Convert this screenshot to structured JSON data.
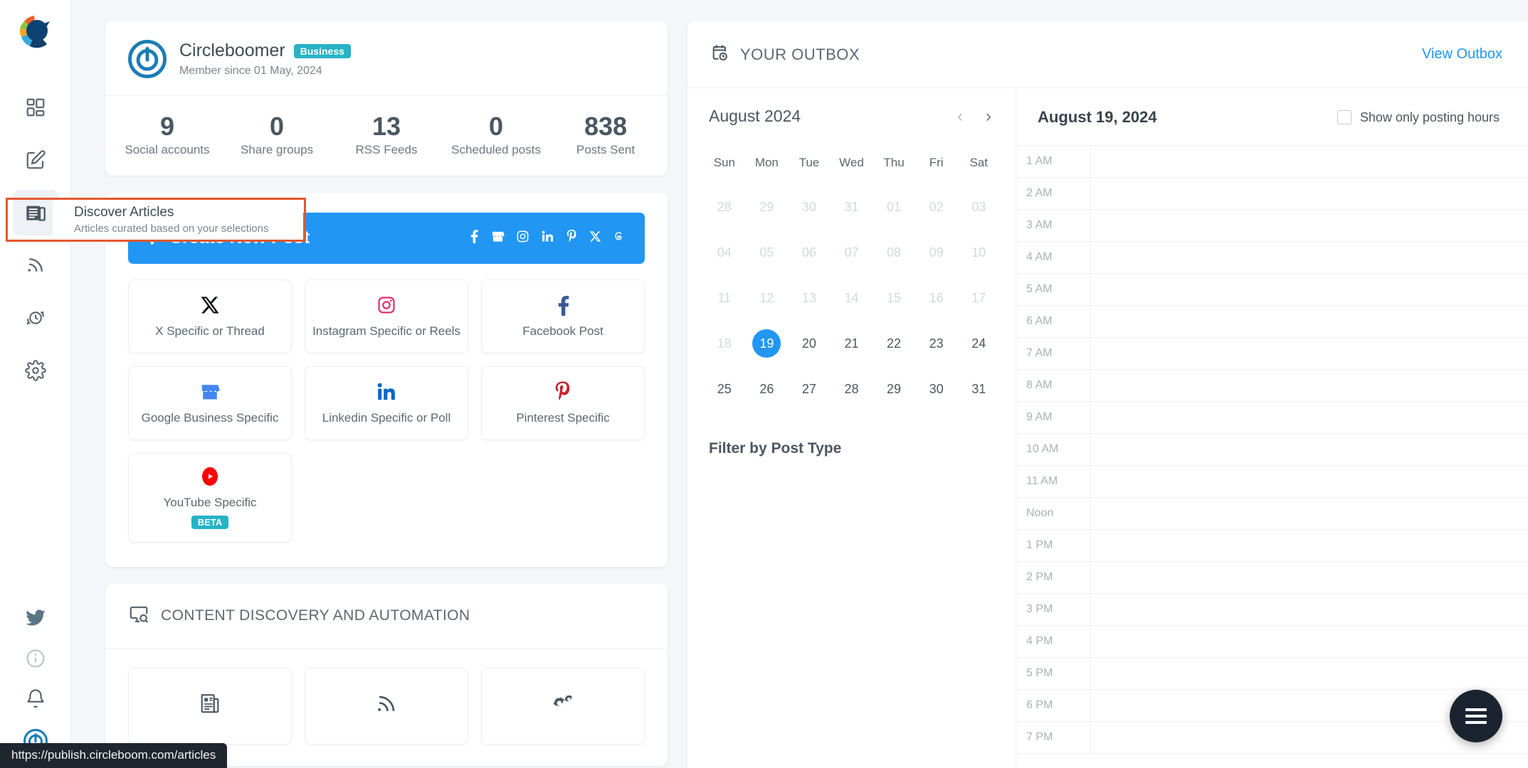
{
  "sidebar": {
    "logo_icon": "circleboom-logo-icon",
    "items": [
      {
        "icon": "dashboard-grid-icon",
        "name": "dashboard",
        "active": false
      },
      {
        "icon": "compose-edit-icon",
        "name": "compose",
        "active": false
      },
      {
        "icon": "articles-newspaper-icon",
        "name": "articles",
        "active": true
      },
      {
        "icon": "rss-feed-icon",
        "name": "rss",
        "active": false
      },
      {
        "icon": "queue-history-icon",
        "name": "queue",
        "active": false
      },
      {
        "icon": "settings-gear-icon",
        "name": "settings",
        "active": false
      }
    ],
    "bottom_items": [
      {
        "icon": "twitter-bird-icon",
        "name": "twitter"
      },
      {
        "icon": "info-circle-icon",
        "name": "info"
      },
      {
        "icon": "bell-icon",
        "name": "notifications"
      },
      {
        "icon": "circleboom-avatar-icon",
        "name": "account"
      }
    ],
    "tooltip": {
      "title": "Discover Articles",
      "subtitle": "Articles curated based on your selections",
      "highlight_color": "#e4572e"
    }
  },
  "profile": {
    "avatar_icon": "circleboom-avatar-icon",
    "name": "Circleboomer",
    "plan_badge": "Business",
    "member_since": "Member since 01 May, 2024",
    "stats": [
      {
        "value": "9",
        "label": "Social accounts"
      },
      {
        "value": "0",
        "label": "Share groups"
      },
      {
        "value": "13",
        "label": "RSS Feeds"
      },
      {
        "value": "0",
        "label": "Scheduled posts"
      },
      {
        "value": "838",
        "label": "Posts Sent"
      }
    ]
  },
  "compose": {
    "create_label": "Create New Post",
    "plus_icon": "plus-icon",
    "accent_color": "#2196f3",
    "network_icons": [
      "facebook-icon",
      "google-business-icon",
      "instagram-icon",
      "linkedin-icon",
      "pinterest-icon",
      "x-twitter-icon",
      "threads-icon"
    ],
    "tiles": [
      {
        "label": "X Specific or Thread",
        "icon": "x-twitter-icon",
        "badge": ""
      },
      {
        "label": "Instagram Specific or Reels",
        "icon": "instagram-icon",
        "badge": ""
      },
      {
        "label": "Facebook Post",
        "icon": "facebook-icon",
        "badge": ""
      },
      {
        "label": "Google Business Specific",
        "icon": "google-business-icon",
        "badge": ""
      },
      {
        "label": "Linkedin Specific or Poll",
        "icon": "linkedin-icon",
        "badge": ""
      },
      {
        "label": "Pinterest Specific",
        "icon": "pinterest-icon",
        "badge": ""
      },
      {
        "label": "YouTube Specific",
        "icon": "youtube-icon",
        "badge": "BETA"
      }
    ]
  },
  "content_discovery": {
    "title": "CONTENT DISCOVERY AND AUTOMATION",
    "header_icon": "screen-search-icon",
    "tiles": [
      {
        "icon": "articles-newspaper-icon",
        "name": "articles"
      },
      {
        "icon": "rss-feed-icon",
        "name": "rss"
      },
      {
        "icon": "automation-gears-icon",
        "name": "automation"
      }
    ]
  },
  "outbox": {
    "title": "YOUR OUTBOX",
    "title_icon": "calendar-clock-icon",
    "view_link": "View Outbox",
    "calendar": {
      "month_label": "August 2024",
      "prev_icon": "chevron-left-icon",
      "next_icon": "chevron-right-icon",
      "dow": [
        "Sun",
        "Mon",
        "Tue",
        "Wed",
        "Thu",
        "Fri",
        "Sat"
      ],
      "weeks": [
        [
          {
            "d": "28",
            "muted": true
          },
          {
            "d": "29",
            "muted": true
          },
          {
            "d": "30",
            "muted": true
          },
          {
            "d": "31",
            "muted": true
          },
          {
            "d": "01",
            "muted": true
          },
          {
            "d": "02",
            "muted": true
          },
          {
            "d": "03",
            "muted": true
          }
        ],
        [
          {
            "d": "04",
            "muted": true
          },
          {
            "d": "05",
            "muted": true
          },
          {
            "d": "06",
            "muted": true
          },
          {
            "d": "07",
            "muted": true
          },
          {
            "d": "08",
            "muted": true
          },
          {
            "d": "09",
            "muted": true
          },
          {
            "d": "10",
            "muted": true
          }
        ],
        [
          {
            "d": "11",
            "muted": true
          },
          {
            "d": "12",
            "muted": true
          },
          {
            "d": "13",
            "muted": true
          },
          {
            "d": "14",
            "muted": true
          },
          {
            "d": "15",
            "muted": true
          },
          {
            "d": "16",
            "muted": true
          },
          {
            "d": "17",
            "muted": true
          }
        ],
        [
          {
            "d": "18",
            "muted": true
          },
          {
            "d": "19",
            "muted": false,
            "selected": true
          },
          {
            "d": "20",
            "muted": false
          },
          {
            "d": "21",
            "muted": false
          },
          {
            "d": "22",
            "muted": false
          },
          {
            "d": "23",
            "muted": false
          },
          {
            "d": "24",
            "muted": false
          }
        ],
        [
          {
            "d": "25",
            "muted": false
          },
          {
            "d": "26",
            "muted": false
          },
          {
            "d": "27",
            "muted": false
          },
          {
            "d": "28",
            "muted": false
          },
          {
            "d": "29",
            "muted": false
          },
          {
            "d": "30",
            "muted": false
          },
          {
            "d": "31",
            "muted": false
          }
        ]
      ],
      "selected_color": "#2196f3"
    },
    "filter_title": "Filter by Post Type",
    "day": {
      "date_label": "August 19, 2024",
      "checkbox_label": "Show only posting hours",
      "checkbox_checked": false,
      "hours": [
        "1 AM",
        "2 AM",
        "3 AM",
        "4 AM",
        "5 AM",
        "6 AM",
        "7 AM",
        "8 AM",
        "9 AM",
        "10 AM",
        "11 AM",
        "Noon",
        "1 PM",
        "2 PM",
        "3 PM",
        "4 PM",
        "5 PM",
        "6 PM",
        "7 PM"
      ]
    }
  },
  "fab": {
    "icon": "hamburger-menu-icon",
    "color": "#1b2330"
  },
  "statusbar": {
    "url": "https://publish.circleboom.com/articles"
  }
}
